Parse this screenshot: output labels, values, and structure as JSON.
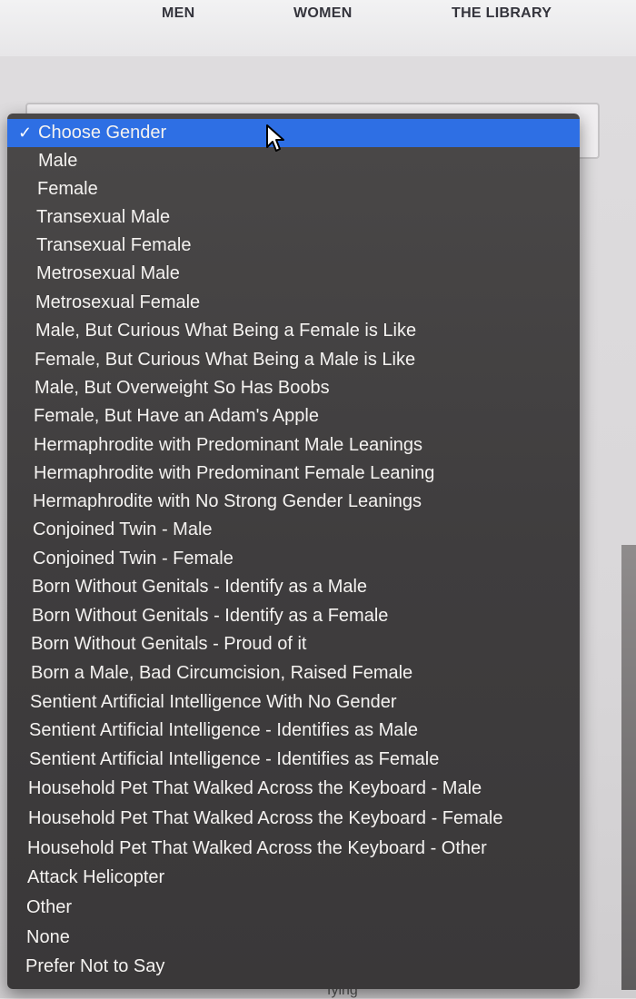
{
  "nav": {
    "men": "MEN",
    "women": "WOMEN",
    "library": "THE LIBRARY"
  },
  "dropdown": {
    "selected_check": "✓",
    "options": [
      "Choose Gender",
      "Male",
      "Female",
      "Transexual Male",
      "Transexual Female",
      "Metrosexual Male",
      "Metrosexual Female",
      "Male, But Curious What Being a Female is Like",
      "Female, But Curious What Being a Male is Like",
      "Male, But Overweight So Has Boobs",
      "Female, But Have an Adam's Apple",
      "Hermaphrodite with Predominant Male Leanings",
      "Hermaphrodite with Predominant Female Leaning",
      "Hermaphrodite with No Strong Gender Leanings",
      "Conjoined Twin - Male",
      "Conjoined Twin - Female",
      "Born Without Genitals - Identify as a Male",
      "Born Without Genitals - Identify as a Female",
      "Born Without Genitals - Proud of it",
      "Born a Male, Bad Circumcision, Raised Female",
      "Sentient Artificial Intelligence With No Gender",
      "Sentient Artificial Intelligence - Identifies as Male",
      "Sentient Artificial Intelligence - Identifies as Female",
      "Household Pet That Walked Across the Keyboard - Male",
      "Household Pet That Walked Across the Keyboard - Female",
      "Household Pet That Walked Across the Keyboard - Other",
      "Attack Helicopter",
      "Other",
      "None",
      "Prefer Not to Say"
    ]
  },
  "background": {
    "partial_text": "fying"
  },
  "colors": {
    "selected": "#2e6fe4",
    "menu_bg": "#434142",
    "menu_text": "#f4f2f0"
  }
}
